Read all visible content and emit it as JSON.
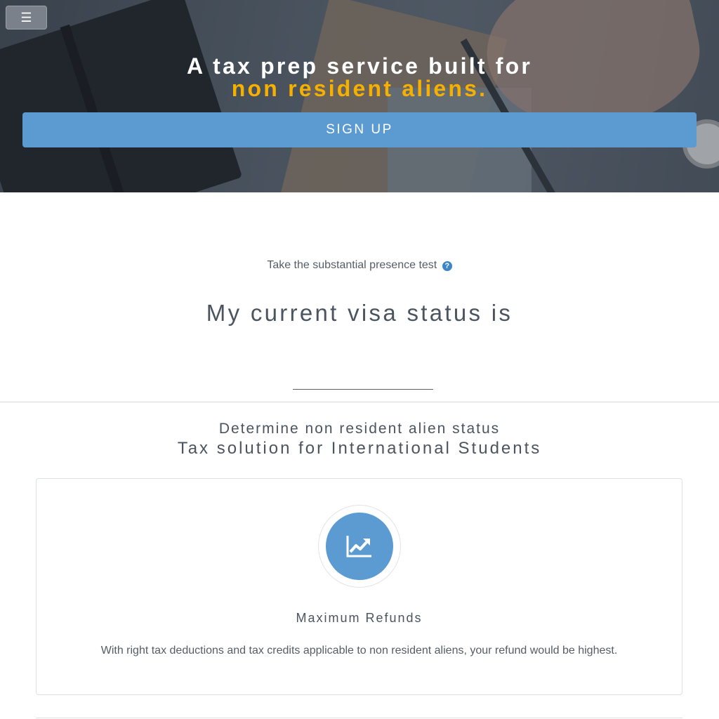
{
  "hero": {
    "menu_icon": "hamburger-icon",
    "title_line1": "A tax prep service built for",
    "title_line2": "non resident aliens.",
    "accent_color": "#f6b000",
    "signup_label": "SIGN UP",
    "signup_color": "#5b9bd1"
  },
  "status": {
    "title": "Determine non resident alien status",
    "test_text": "Take the substantial presence test",
    "help_icon": "question-circle-icon",
    "visa_text": "My current visa status is"
  },
  "features": {
    "title": "Tax solution for International Students",
    "items": [
      {
        "icon": "chart-line-icon",
        "name": "Maximum Refunds",
        "description": "With right tax deductions and tax credits applicable to non resident aliens, your refund would be highest."
      }
    ]
  }
}
